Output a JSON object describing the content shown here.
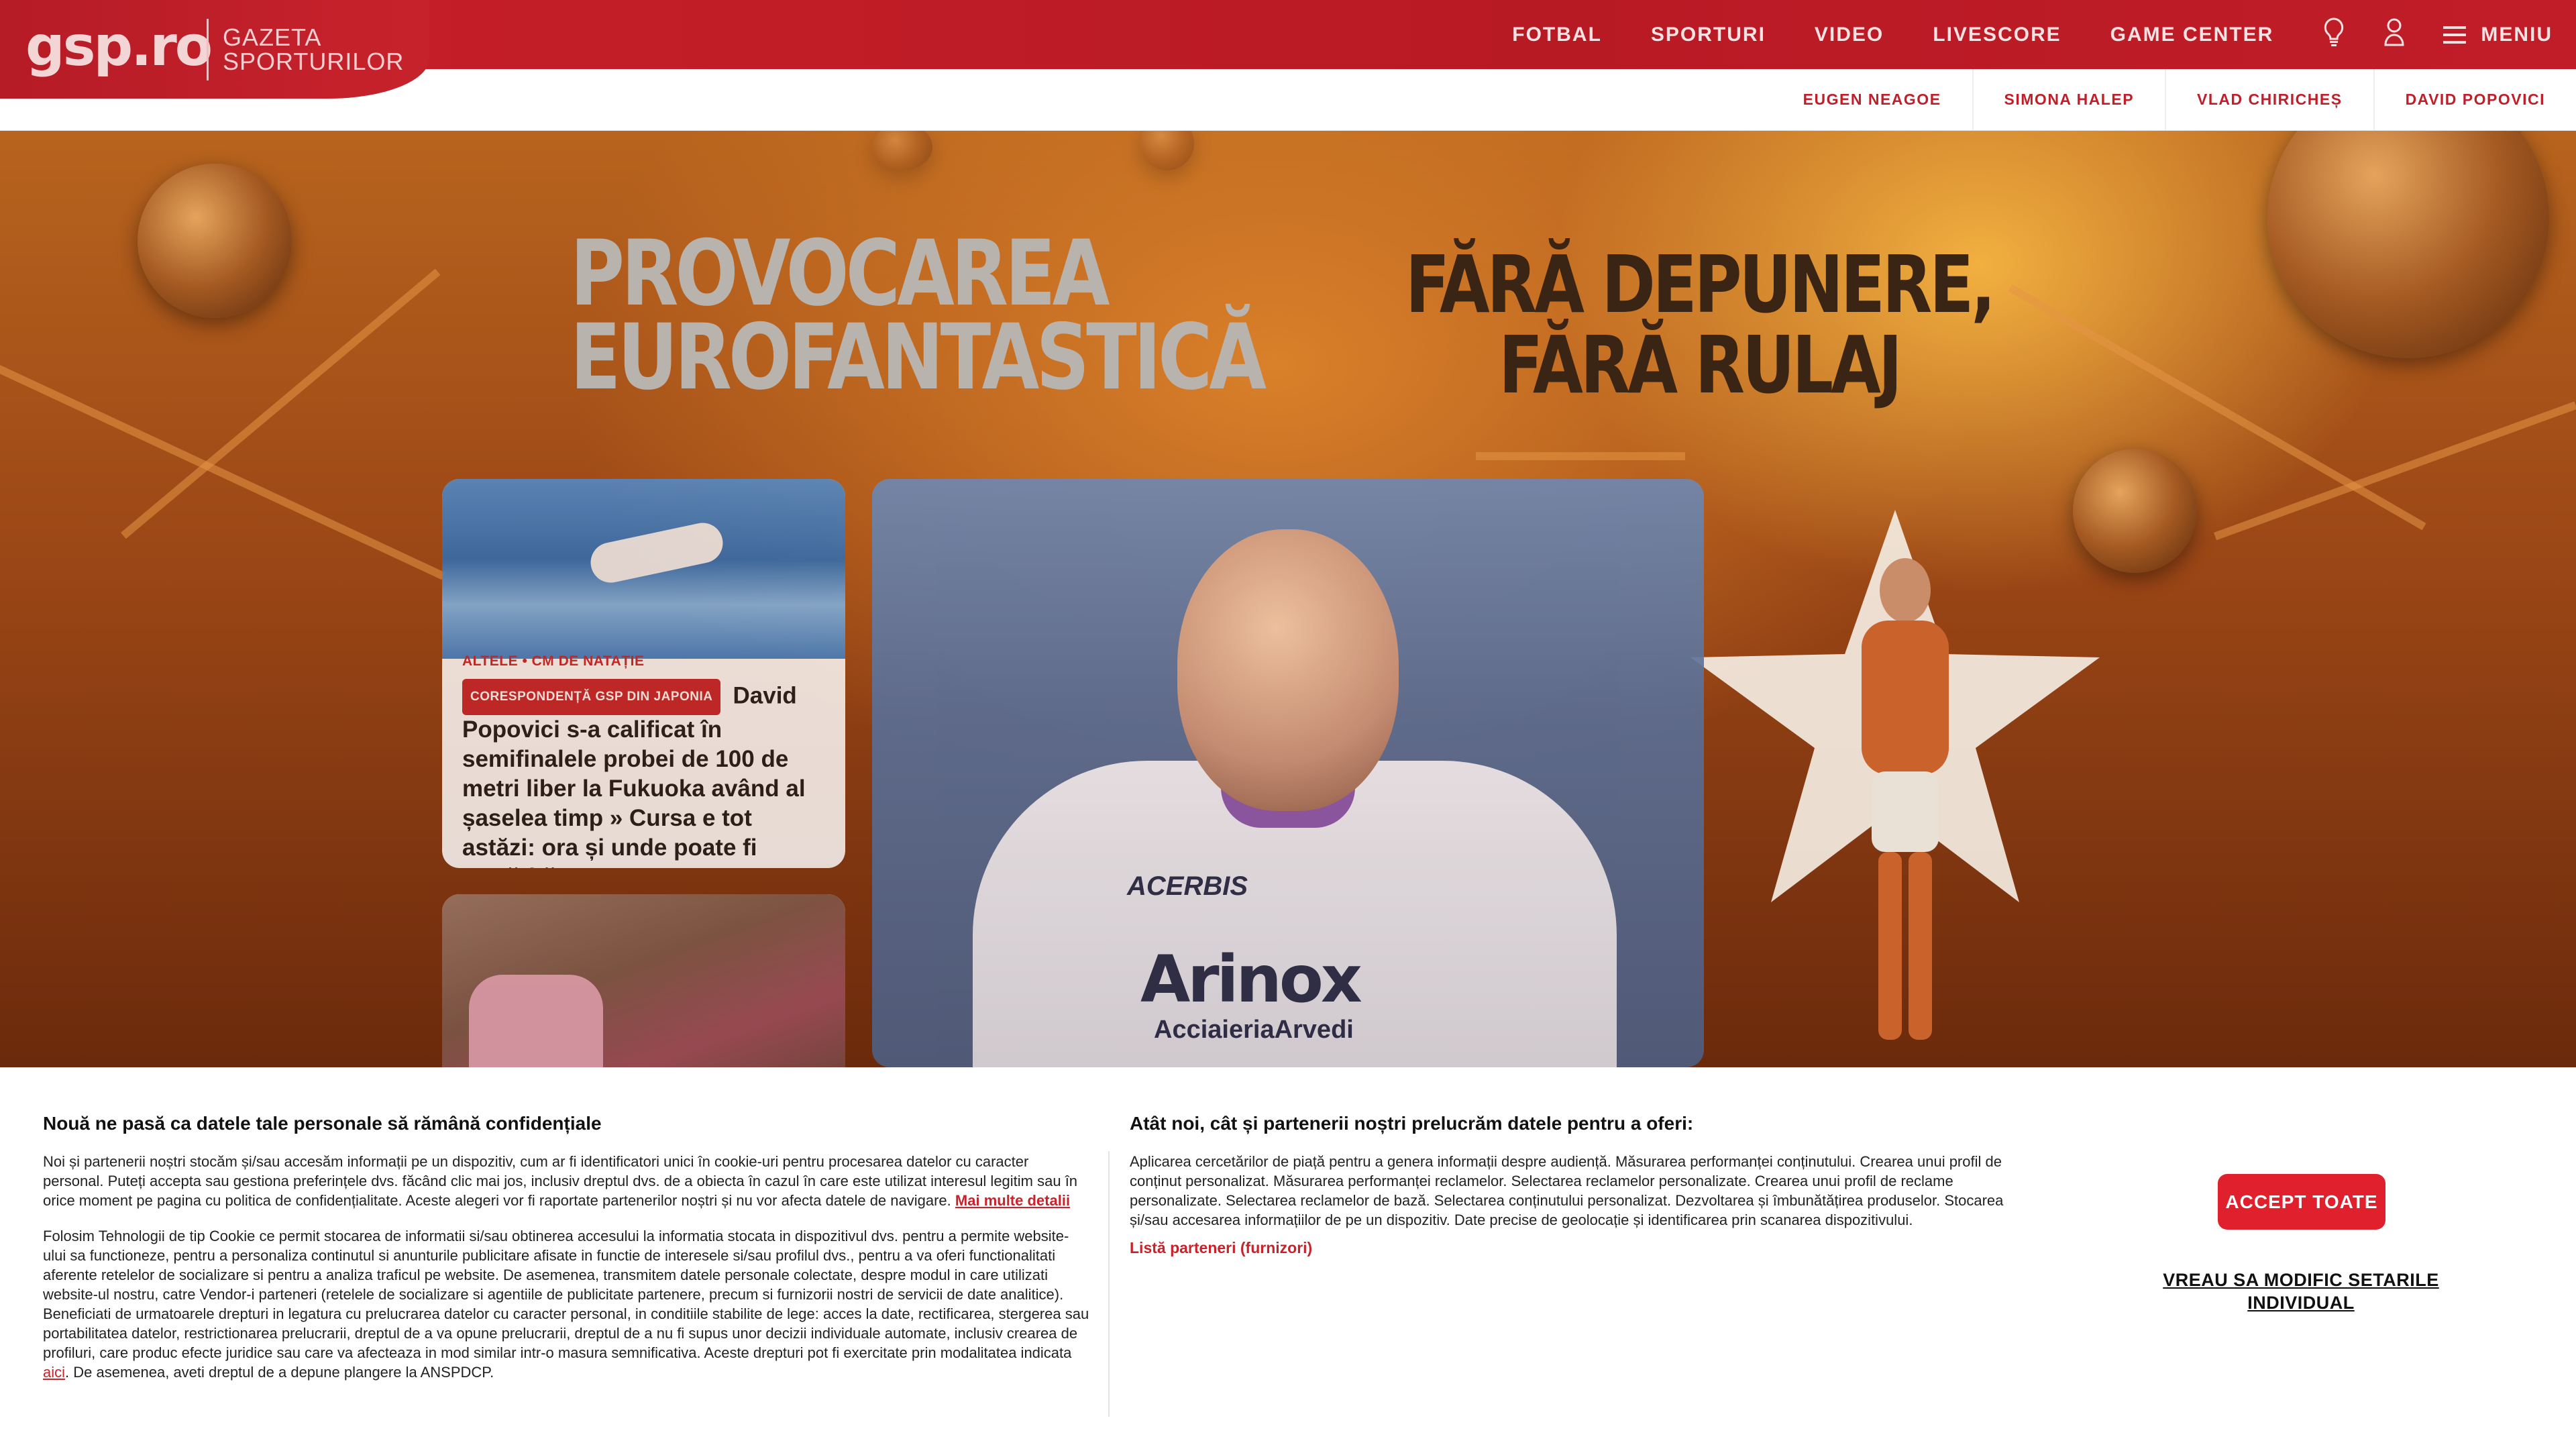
{
  "header": {
    "logo_text": "gsp.ro",
    "logo_subtitle_line1": "GAZETA",
    "logo_subtitle_line2": "SPORTURILOR",
    "nav": [
      "FOTBAL",
      "SPORTURI",
      "VIDEO",
      "LIVESCORE",
      "GAME CENTER"
    ],
    "menu_label": "MENIU",
    "icons": [
      "lightbulb-icon",
      "user-icon",
      "hamburger-icon"
    ]
  },
  "tags": [
    "EUGEN NEAGOE",
    "SIMONA HALEP",
    "VLAD CHIRICHEȘ",
    "DAVID POPOVICI"
  ],
  "promo": {
    "left_line1": "PROVOCAREA",
    "left_line2": "EUROFANTASTICĂ",
    "right_line1": "FĂRĂ DEPUNERE,",
    "right_line2": "FĂRĂ RULAJ"
  },
  "articles": [
    {
      "category": "ALTELE",
      "subcategory": "CM DE NATAȚIE",
      "badge": "CORESPONDENȚĂ GSP DIN JAPONIA",
      "headline": "David Popovici s-a calificat în semifinalele probei de 100 de metri liber la Fukuoka având al șaselea timp » Cursa e tot astăzi: ora și unde poate fi urmărită"
    }
  ],
  "main_image": {
    "sponsor": "Arinox",
    "sponsor_sub": "AcciaieriaArvedi",
    "kit_brand": "ACERBIS"
  },
  "cookie": {
    "title_left": "Nouă ne pasă ca datele tale personale să rămână confidențiale",
    "para1": "Noi și partenerii noștri stocăm și/sau accesăm informații pe un dispozitiv, cum ar fi identificatori unici în cookie-uri pentru procesarea datelor cu caracter personal. Puteți accepta sau gestiona preferințele dvs. făcând clic mai jos, inclusiv dreptul dvs. de a obiecta în cazul în care este utilizat interesul legitim sau în orice moment pe pagina cu politica de confidențialitate. Aceste alegeri vor fi raportate partenerilor noștri și nu vor afecta datele de navigare.",
    "more_link": "Mai multe detalii",
    "para2": "Folosim Tehnologii de tip Cookie ce permit stocarea de informatii si/sau obtinerea accesului la informatia stocata in dispozitivul dvs. pentru a permite website-ului sa functioneze, pentru a personaliza continutul si anunturile publicitare afisate in functie de interesele si/sau profilul dvs., pentru a va oferi functionalitati aferente retelelor de socializare si pentru a analiza traficul pe website. De asemenea, transmitem datele personale colectate, despre modul in care utilizati website-ul nostru, catre Vendor-i parteneri (retelele de socializare si agentiile de publicitate partenere, precum si furnizorii nostri de servicii de date analitice). Beneficiati de urmatoarele drepturi in legatura cu prelucrarea datelor cu caracter personal, in conditiile stabilite de lege: acces la date, rectificarea, stergerea sau portabilitatea datelor, restrictionarea prelucrarii, dreptul de a va opune prelucrarii, dreptul de a nu fi supus unor decizii individuale automate, inclusiv crearea de profiluri, care produc efecte juridice sau care va afecteaza in mod similar intr-o masura semnificativa. Aceste drepturi pot fi exercitate prin modalitatea indicata",
    "here_link": "aici",
    "para2_end": ". De asemenea, aveti dreptul de a depune plangere la ANSPDCP.",
    "title_right": "Atât noi, cât și partenerii noștri prelucrăm datele pentru a oferi:",
    "purposes": "Aplicarea cercetărilor de piață pentru a genera informații despre audiență. Măsurarea performanței conținutului. Crearea unui profil de conținut personalizat. Măsurarea performanței reclamelor. Selectarea reclamelor personalizate. Crearea unui profil de reclame personalizate. Selectarea reclamelor de bază. Selectarea conținutului personalizat. Dezvoltarea și îmbunătățirea produselor. Stocarea și/sau accesarea informațiilor de pe un dispozitiv. Date precise de geolocație și identificarea prin scanarea dispozitivului.",
    "partners_link": "Listă parteneri (furnizori)",
    "accept_label": "ACCEPT TOATE",
    "customize_label": "VREAU SA MODIFIC SETARILE INDIVIDUAL"
  },
  "colors": {
    "brand_red": "#c8202a",
    "accept_red": "#e0202d",
    "hero_orange": "#c0691f"
  }
}
